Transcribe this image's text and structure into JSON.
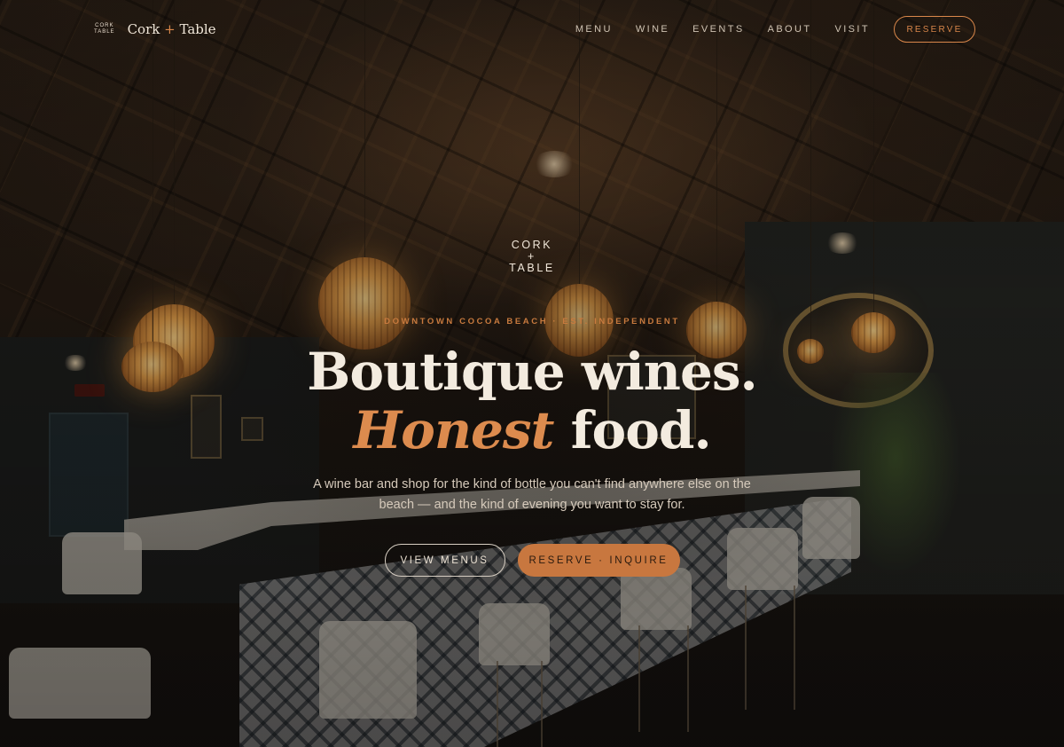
{
  "header": {
    "mini_logo": {
      "line1": "CORK",
      "line2": "+",
      "line3": "TABLE"
    },
    "brand": {
      "first": "Cork",
      "plus": "+",
      "second": "Table"
    },
    "nav": [
      {
        "label": "MENU"
      },
      {
        "label": "WINE"
      },
      {
        "label": "EVENTS"
      },
      {
        "label": "ABOUT"
      },
      {
        "label": "VISIT"
      }
    ],
    "cta_label": "RESERVE"
  },
  "hero": {
    "logo": {
      "line1": "CORK",
      "line2": "+",
      "line3": "TABLE"
    },
    "eyebrow": "DOWNTOWN COCOA BEACH · EST. INDEPENDENT",
    "headline_line1": "Boutique wines.",
    "headline_accent": "Honest",
    "headline_rest": "food.",
    "subcopy": "A wine bar and shop for the kind of bottle you can't find anywhere else on the beach — and the kind of evening you want to stay for.",
    "buttons": {
      "secondary": "VIEW MENUS",
      "primary": "RESERVE · INQUIRE"
    }
  },
  "colors": {
    "accent": "#d9874a",
    "primary_button": "#c8773f",
    "text_light": "#f3ebdf",
    "background_dark": "#1a1410"
  },
  "icons": [
    "cork-table-logo"
  ]
}
